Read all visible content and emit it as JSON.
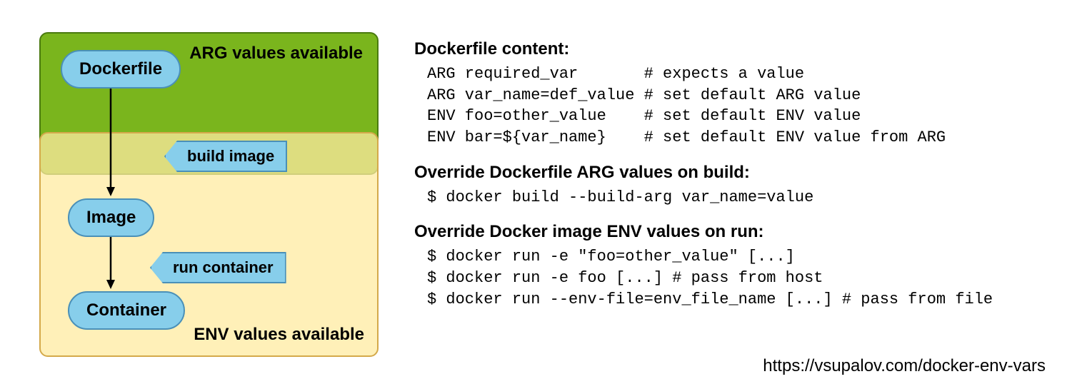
{
  "diagram": {
    "arg_box_label": "ARG values available",
    "env_box_label": "ENV values available",
    "nodes": {
      "dockerfile": "Dockerfile",
      "image": "Image",
      "container": "Container"
    },
    "edges": {
      "build": "build image",
      "run": "run container"
    }
  },
  "sections": {
    "dockerfile": {
      "heading": "Dockerfile content:",
      "lines": [
        "ARG required_var       # expects a value",
        "ARG var_name=def_value # set default ARG value",
        "ENV foo=other_value    # set default ENV value",
        "ENV bar=${var_name}    # set default ENV value from ARG"
      ]
    },
    "build": {
      "heading": "Override Dockerfile ARG values on build:",
      "lines": [
        "$ docker build --build-arg var_name=value"
      ]
    },
    "run": {
      "heading": "Override Docker image ENV values on run:",
      "lines": [
        "$ docker run -e \"foo=other_value\" [...]",
        "$ docker run -e foo [...] # pass from host",
        "$ docker run --env-file=env_file_name [...] # pass from file"
      ]
    }
  },
  "source_url": "https://vsupalov.com/docker-env-vars"
}
